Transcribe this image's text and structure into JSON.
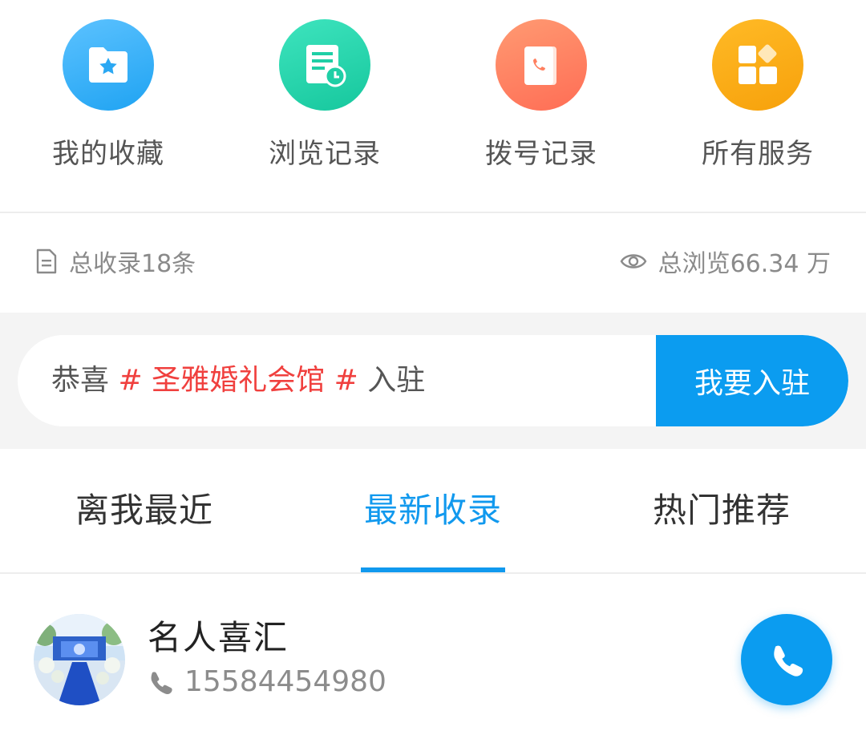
{
  "quick_entries": [
    {
      "label": "我的收藏",
      "icon": "folder-star-icon",
      "color": "#34aef5"
    },
    {
      "label": "浏览记录",
      "icon": "document-clock-icon",
      "color": "#24d3ad"
    },
    {
      "label": "拨号记录",
      "icon": "phone-book-icon",
      "color": "#ff7f5f"
    },
    {
      "label": "所有服务",
      "icon": "grid-apps-icon",
      "color": "#fbab12"
    }
  ],
  "stats": {
    "total_records": "总收录18条",
    "total_views": "总浏览66.34 万"
  },
  "banner": {
    "prefix": "恭喜",
    "hash_open": "#",
    "venue": "圣雅婚礼会馆",
    "hash_close": "#",
    "suffix": "入驻",
    "join_button": "我要入驻"
  },
  "tabs": [
    {
      "label": "离我最近",
      "active": false
    },
    {
      "label": "最新收录",
      "active": true
    },
    {
      "label": "热门推荐",
      "active": false
    }
  ],
  "listing": {
    "name": "名人喜汇",
    "phone": "15584454980"
  },
  "colors": {
    "accent": "#0b9cf0",
    "highlight_red": "#f0403e"
  }
}
